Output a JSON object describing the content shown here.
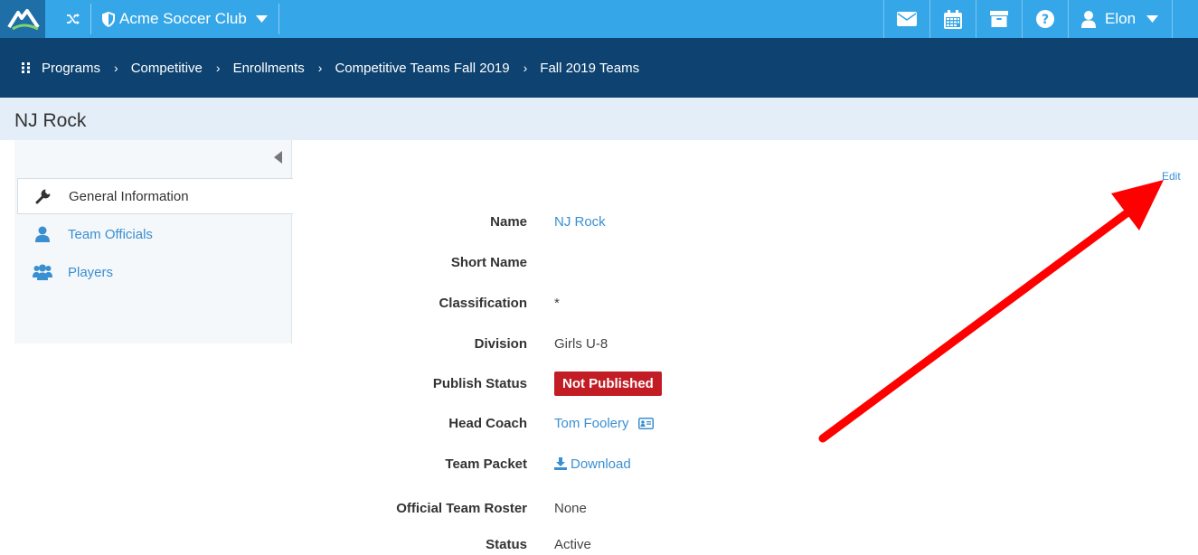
{
  "topbar": {
    "club_name": "Acme Soccer Club",
    "user_name": "Elon",
    "icons": [
      "mail-icon",
      "calendar-icon",
      "archive-icon",
      "help-icon",
      "user-icon"
    ]
  },
  "breadcrumbs": [
    "Programs",
    "Competitive",
    "Enrollments",
    "Competitive Teams Fall 2019",
    "Fall 2019 Teams"
  ],
  "page": {
    "title": "NJ Rock"
  },
  "sidebar": {
    "items": [
      {
        "label": "General Information",
        "active": true
      },
      {
        "label": "Team Officials",
        "active": false
      },
      {
        "label": "Players",
        "active": false
      }
    ]
  },
  "main": {
    "edit_label": "Edit",
    "fields": {
      "name": {
        "label": "Name",
        "value": "NJ Rock"
      },
      "short_name": {
        "label": "Short Name",
        "value": ""
      },
      "classification": {
        "label": "Classification",
        "value": "*"
      },
      "division": {
        "label": "Division",
        "value": "Girls U-8"
      },
      "publish_status": {
        "label": "Publish Status",
        "value": "Not Published"
      },
      "head_coach": {
        "label": "Head Coach",
        "value": "Tom Foolery"
      },
      "team_packet": {
        "label": "Team Packet",
        "value": "Download"
      },
      "official_roster": {
        "label": "Official Team Roster",
        "value": "None"
      },
      "status": {
        "label": "Status",
        "value": "Active"
      }
    }
  },
  "colors": {
    "topbar": "#35a7e8",
    "breadcrumb_bar": "#0d4271",
    "page_header": "#e3eef9",
    "link": "#3a8fd1",
    "badge_red": "#c21c24",
    "annotation_arrow": "#ff0000"
  }
}
